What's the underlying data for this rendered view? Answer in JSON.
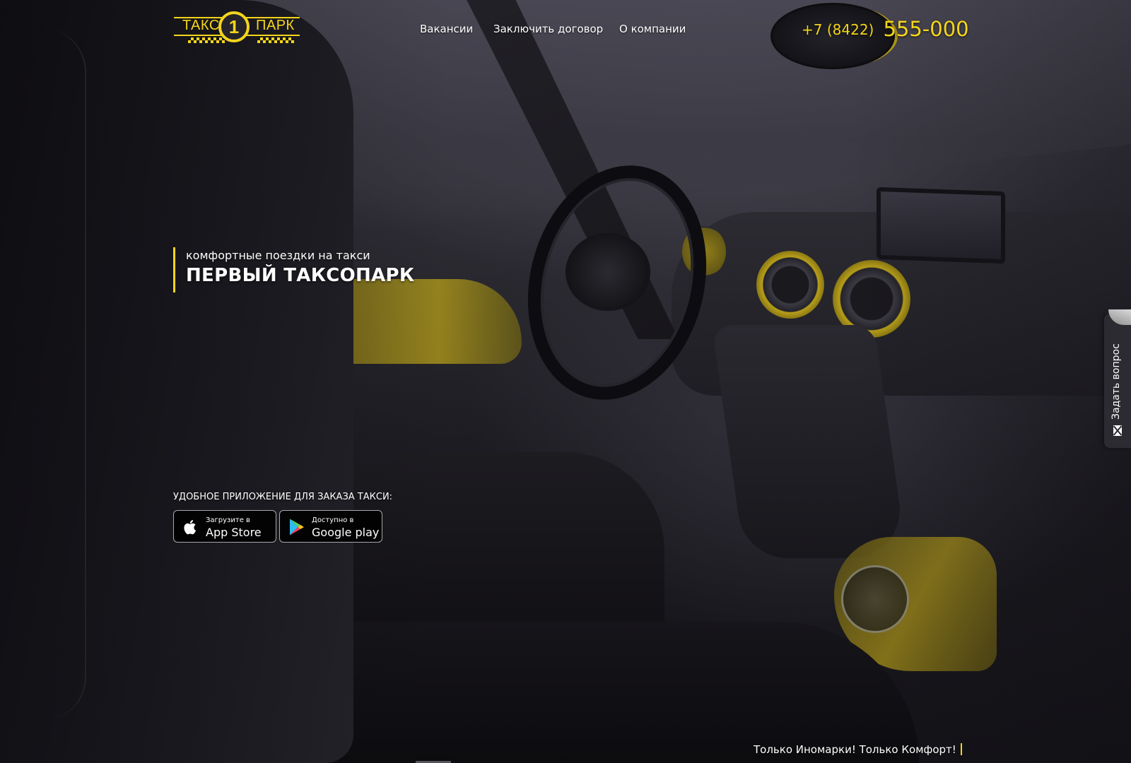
{
  "logo": {
    "left_word": "ТАКС",
    "number": "1",
    "right_word": "ПАРК",
    "brand_color": "#f4d51b"
  },
  "nav": {
    "items": [
      {
        "label": "Вакансии"
      },
      {
        "label": "Заключить договор"
      },
      {
        "label": "О компании"
      }
    ]
  },
  "phone": {
    "prefix": "+7 (8422)",
    "number": "555-000"
  },
  "hero": {
    "subtitle": "комфортные поездки на такси",
    "title": "ПЕРВЫЙ ТАКСОПАРК"
  },
  "apps": {
    "label": "УДОБНОЕ ПРИЛОЖЕНИЕ ДЛЯ ЗАКАЗА ТАКСИ:",
    "app_store": {
      "small": "Загрузите в",
      "big": "App Store",
      "icon": "apple-icon"
    },
    "google_play": {
      "small": "Доступно в",
      "big": "Google play",
      "icon": "google-play-icon"
    }
  },
  "side_tab": {
    "label": "Задать вопрос",
    "icon": "mail-icon"
  },
  "slogan": {
    "text": "Только Иномарки! Только Комфорт!"
  },
  "colors": {
    "accent": "#f4d51b",
    "background": "#1b1a21",
    "text": "#ffffff"
  }
}
